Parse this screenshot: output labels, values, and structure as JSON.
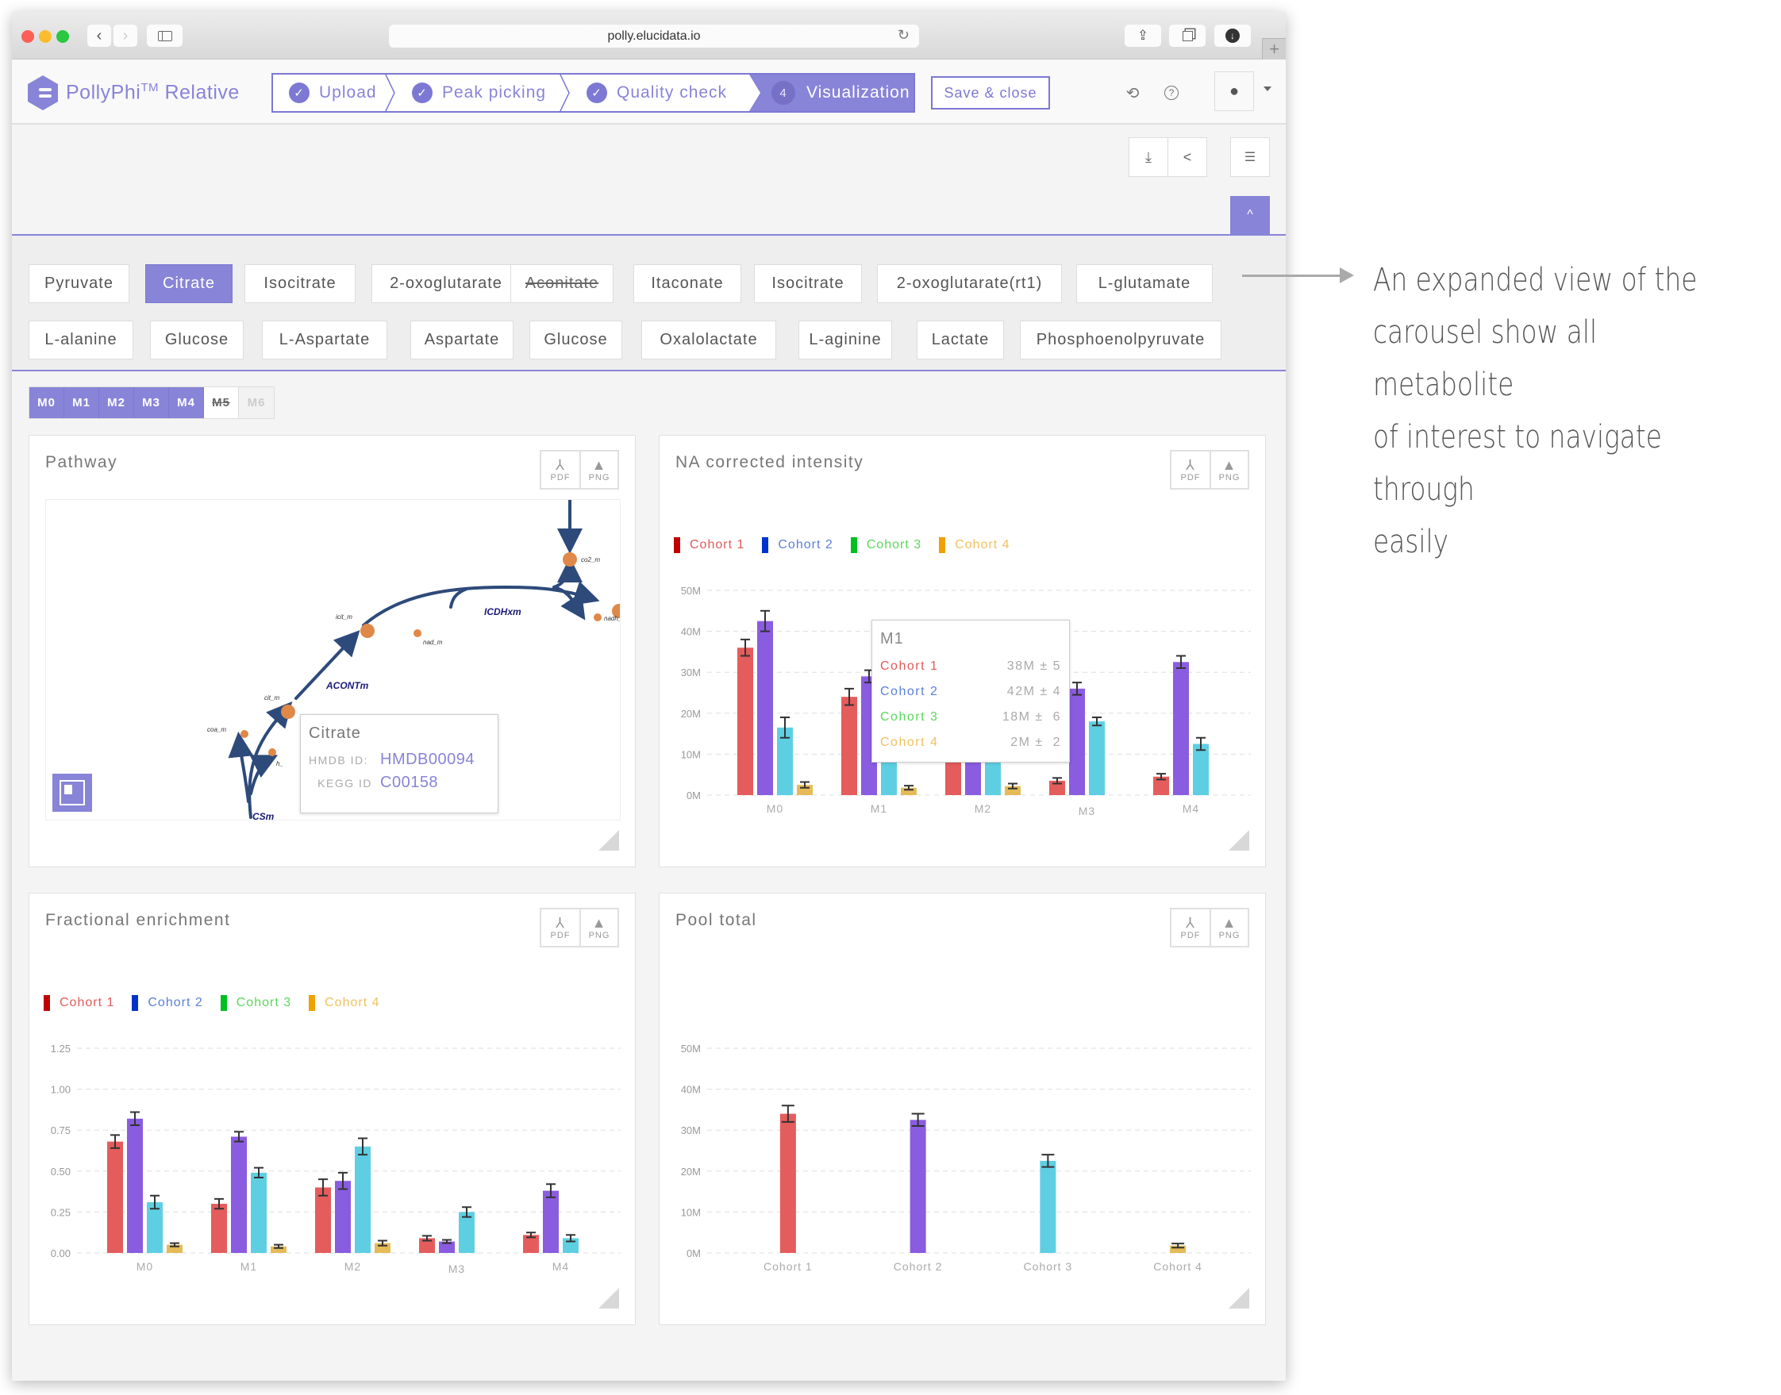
{
  "browser": {
    "url": "polly.elucidata.io",
    "icons": {
      "back": "chevron-left-icon",
      "forward": "chevron-right-icon",
      "sidebar": "sidebar-icon",
      "reload": "reload-icon",
      "share": "share-icon",
      "tabs": "tabs-icon",
      "download": "download-icon",
      "new_tab": "plus-icon"
    }
  },
  "app": {
    "brand": "PollyPhi",
    "brand_sup": "TM",
    "brand_suffix": "Relative",
    "steps": [
      {
        "label": "Upload",
        "state": "done"
      },
      {
        "label": "Peak picking",
        "state": "done"
      },
      {
        "label": "Quality check",
        "state": "done"
      },
      {
        "label": "Visualization",
        "state": "active",
        "number": "4"
      }
    ],
    "save_label": "Save & close",
    "accent": "#8884d8"
  },
  "toolbar": {
    "download_icon": "download-icon",
    "share_icon": "share-icon",
    "filter_icon": "filter-icon",
    "collapse_icon": "chevron-up-icon"
  },
  "metabolites": {
    "row1": [
      {
        "label": "Pyruvate",
        "state": "normal"
      },
      {
        "label": "Citrate",
        "state": "active"
      },
      {
        "label": "Isocitrate",
        "state": "normal"
      },
      {
        "label": "2-oxoglutarate",
        "state": "normal"
      },
      {
        "label": "Aconitate",
        "state": "strike"
      },
      {
        "label": "Itaconate",
        "state": "normal"
      },
      {
        "label": "Isocitrate",
        "state": "normal"
      },
      {
        "label": "2-oxoglutarate(rt1)",
        "state": "normal"
      },
      {
        "label": "L-glutamate",
        "state": "normal"
      }
    ],
    "row2": [
      {
        "label": "L-alanine",
        "state": "normal"
      },
      {
        "label": "Glucose",
        "state": "normal"
      },
      {
        "label": "L-Aspartate",
        "state": "normal"
      },
      {
        "label": "Aspartate",
        "state": "normal"
      },
      {
        "label": "Glucose",
        "state": "normal"
      },
      {
        "label": "Oxalolactate",
        "state": "normal"
      },
      {
        "label": "L-aginine",
        "state": "normal"
      },
      {
        "label": "Lactate",
        "state": "normal"
      },
      {
        "label": "Phosphoenolpyruvate",
        "state": "normal"
      }
    ]
  },
  "isotopes": [
    {
      "label": "M0",
      "state": "on"
    },
    {
      "label": "M1",
      "state": "on"
    },
    {
      "label": "M2",
      "state": "on"
    },
    {
      "label": "M3",
      "state": "on"
    },
    {
      "label": "M4",
      "state": "on"
    },
    {
      "label": "M5",
      "state": "off"
    },
    {
      "label": "M6",
      "state": "disabled"
    }
  ],
  "export": {
    "pdf": "PDF",
    "png": "PNG"
  },
  "cohorts": [
    {
      "name": "Cohort 1",
      "legend_color": "#c00000",
      "text_color": "#e05a5a",
      "bar_color": "#e55c5c"
    },
    {
      "name": "Cohort 2",
      "legend_color": "#0033cc",
      "text_color": "#5b7fd8",
      "bar_color": "#8a5ce0"
    },
    {
      "name": "Cohort 3",
      "legend_color": "#00c020",
      "text_color": "#5cd85c",
      "bar_color": "#5ecfe3"
    },
    {
      "name": "Cohort 4",
      "legend_color": "#f0a000",
      "text_color": "#f0c060",
      "bar_color": "#e4bb57"
    }
  ],
  "pathway": {
    "title": "Pathway",
    "nodes": [
      "co2_m",
      "icit_m",
      "nad_m",
      "nadh_",
      "cit_m",
      "coa_m",
      "h_"
    ],
    "reactions": [
      "ICDHxm",
      "ACONTm",
      "CSm"
    ],
    "tooltip": {
      "name": "Citrate",
      "hmdb_label": "HMDB ID:",
      "hmdb_value": "HMDB00094",
      "kegg_label": "KEGG ID",
      "kegg_value": "C00158"
    },
    "minimap_icon": "minimap-icon"
  },
  "na_tooltip": {
    "title": "M1",
    "rows": [
      {
        "name": "Cohort 1",
        "value": "38M ± 5"
      },
      {
        "name": "Cohort 2",
        "value": "42M ± 4"
      },
      {
        "name": "Cohort 3",
        "value": "18M ±  6"
      },
      {
        "name": "Cohort 4",
        "value": "2M ±  2"
      }
    ]
  },
  "annotation": {
    "text": "An expanded view of the carousel show all metabolite of interest to navigate through easily",
    "lines": [
      "An expanded view of the",
      "carousel show all metabolite",
      "of interest to navigate through",
      "easily"
    ]
  },
  "chart_data": [
    {
      "id": "na",
      "type": "bar",
      "title": "NA corrected intensity",
      "categories": [
        "M0",
        "M1",
        "M2",
        "M3",
        "M4"
      ],
      "yticks": [
        "0M",
        "10M",
        "20M",
        "30M",
        "40M",
        "50M"
      ],
      "ylim": [
        0,
        50
      ],
      "yunit": "M",
      "grid": true,
      "legend": "top-left",
      "series": [
        {
          "name": "Cohort 1",
          "values": [
            36,
            24,
            13,
            3.5,
            4.5
          ],
          "errors": [
            2,
            2,
            1.5,
            0.7,
            0.7
          ]
        },
        {
          "name": "Cohort 2",
          "values": [
            42.5,
            29,
            20,
            26,
            32.5
          ],
          "errors": [
            2.5,
            1.5,
            2,
            1.5,
            1.5
          ]
        },
        {
          "name": "Cohort 3",
          "values": [
            16.5,
            18,
            12,
            18,
            12.5
          ],
          "errors": [
            2.5,
            2,
            1.5,
            1,
            1.5
          ]
        },
        {
          "name": "Cohort 4",
          "values": [
            2.5,
            1.8,
            2.2,
            0,
            0
          ],
          "errors": [
            0.7,
            0.5,
            0.6,
            0,
            0
          ]
        }
      ]
    },
    {
      "id": "fe",
      "type": "bar",
      "title": "Fractional enrichment",
      "categories": [
        "M0",
        "M1",
        "M2",
        "M3",
        "M4"
      ],
      "yticks": [
        "0.00",
        "0.25",
        "0.50",
        "0.75",
        "1.00",
        "1.25"
      ],
      "ylim": [
        0,
        1.25
      ],
      "grid": true,
      "legend": "top-left",
      "series": [
        {
          "name": "Cohort 1",
          "values": [
            0.68,
            0.3,
            0.4,
            0.09,
            0.11
          ],
          "errors": [
            0.04,
            0.03,
            0.05,
            0.015,
            0.015
          ]
        },
        {
          "name": "Cohort 2",
          "values": [
            0.82,
            0.71,
            0.44,
            0.07,
            0.38
          ],
          "errors": [
            0.04,
            0.03,
            0.05,
            0.01,
            0.04
          ]
        },
        {
          "name": "Cohort 3",
          "values": [
            0.31,
            0.49,
            0.65,
            0.25,
            0.09
          ],
          "errors": [
            0.04,
            0.03,
            0.05,
            0.03,
            0.02
          ]
        },
        {
          "name": "Cohort 4",
          "values": [
            0.05,
            0.04,
            0.06,
            0,
            0
          ],
          "errors": [
            0.01,
            0.01,
            0.015,
            0,
            0
          ]
        }
      ]
    },
    {
      "id": "pool",
      "type": "bar",
      "title": "Pool total",
      "categories": [
        "Cohort 1",
        "Cohort 2",
        "Cohort 3",
        "Cohort 4"
      ],
      "yticks": [
        "0M",
        "10M",
        "20M",
        "30M",
        "40M",
        "50M"
      ],
      "ylim": [
        0,
        50
      ],
      "yunit": "M",
      "grid": true,
      "legend": "none",
      "values": [
        34,
        32.5,
        22.5,
        1.8
      ],
      "errors": [
        2,
        1.5,
        1.5,
        0.5
      ]
    }
  ]
}
